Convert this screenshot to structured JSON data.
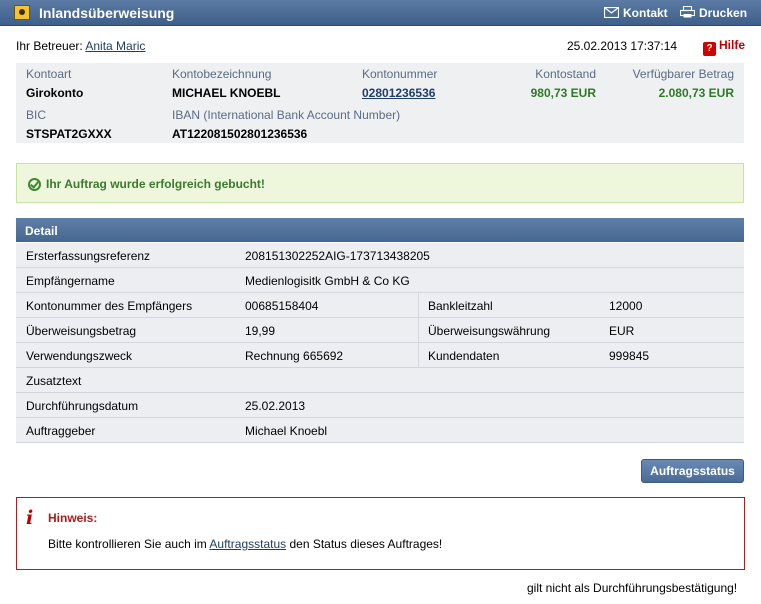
{
  "window": {
    "title": "Inlandsüberweisung",
    "kontakt": "Kontakt",
    "drucken": "Drucken"
  },
  "betreuer": {
    "label": "Ihr Betreuer:",
    "name": "Anita Maric"
  },
  "datetime": "25.02.2013 17:37:14",
  "hilfe": "Hilfe",
  "account": {
    "kontoart_label": "Kontoart",
    "kontoart": "Girokonto",
    "bezeichnung_label": "Kontobezeichnung",
    "bezeichnung": "MICHAEL KNOEBL",
    "nummer_label": "Kontonummer",
    "nummer": "02801236536",
    "stand_label": "Kontostand",
    "stand": "980,73 EUR",
    "verfuegbar_label": "Verfügbarer Betrag",
    "verfuegbar": "2.080,73 EUR",
    "bic_label": "BIC",
    "bic": "STSPAT2GXXX",
    "iban_label": "IBAN (International Bank Account Number)",
    "iban": "AT122081502801236536"
  },
  "success": "Ihr Auftrag wurde erfolgreich gebucht!",
  "detail": {
    "header": "Detail",
    "rows": [
      {
        "label": "Ersterfassungsreferenz",
        "value": "208151302252AIG-173713438205"
      },
      {
        "label": "Empfängername",
        "value": "Medienlogisitk GmbH & Co KG"
      },
      {
        "label": "Kontonummer des Empfängers",
        "value": "00685158404",
        "label2": "Bankleitzahl",
        "value2": "12000"
      },
      {
        "label": "Überweisungsbetrag",
        "value": "19,99",
        "label2": "Überweisungswährung",
        "value2": "EUR"
      },
      {
        "label": "Verwendungszweck",
        "value": "Rechnung 665692",
        "label2": "Kundendaten",
        "value2": "999845"
      },
      {
        "label": "Zusatztext",
        "value": ""
      },
      {
        "label": "Durchführungsdatum",
        "value": "25.02.2013"
      },
      {
        "label": "Auftraggeber",
        "value": "Michael Knoebl"
      }
    ]
  },
  "auftragsstatus_button": "Auftragsstatus",
  "hinweis": {
    "title": "Hinweis:",
    "text_before": "Bitte kontrollieren Sie auch im",
    "link": "Auftragsstatus",
    "text_after": "den Status dieses Auftrages!"
  },
  "footer": "gilt nicht als Durchführungsbestätigung!"
}
